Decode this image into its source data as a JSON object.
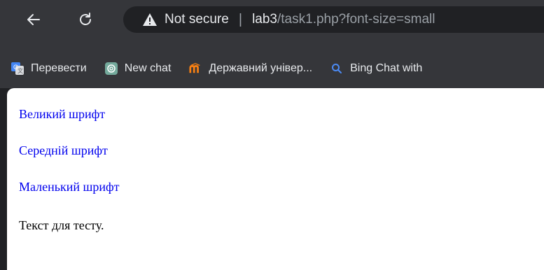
{
  "browser": {
    "security_label": "Not secure",
    "separator": "|",
    "url_host": "lab3",
    "url_path": "/task1.php?font-size=small",
    "colors": {
      "toolbar": "#35363a",
      "omnibox": "#202124",
      "text": "#e8eaed",
      "muted": "#9aa0a6"
    }
  },
  "bookmarks": [
    {
      "label": "Перевести",
      "icon": "google-translate-icon"
    },
    {
      "label": "New chat",
      "icon": "chatgpt-icon"
    },
    {
      "label": "Державний універ...",
      "icon": "moodle-icon"
    },
    {
      "label": "Bing Chat with",
      "icon": "search-icon"
    }
  ],
  "page": {
    "links": {
      "large": "Великий шрифт",
      "medium": "Середній шрифт",
      "small": "Маленький шрифт"
    },
    "text": "Текст для тесту.",
    "link_color": "#0000ee"
  }
}
